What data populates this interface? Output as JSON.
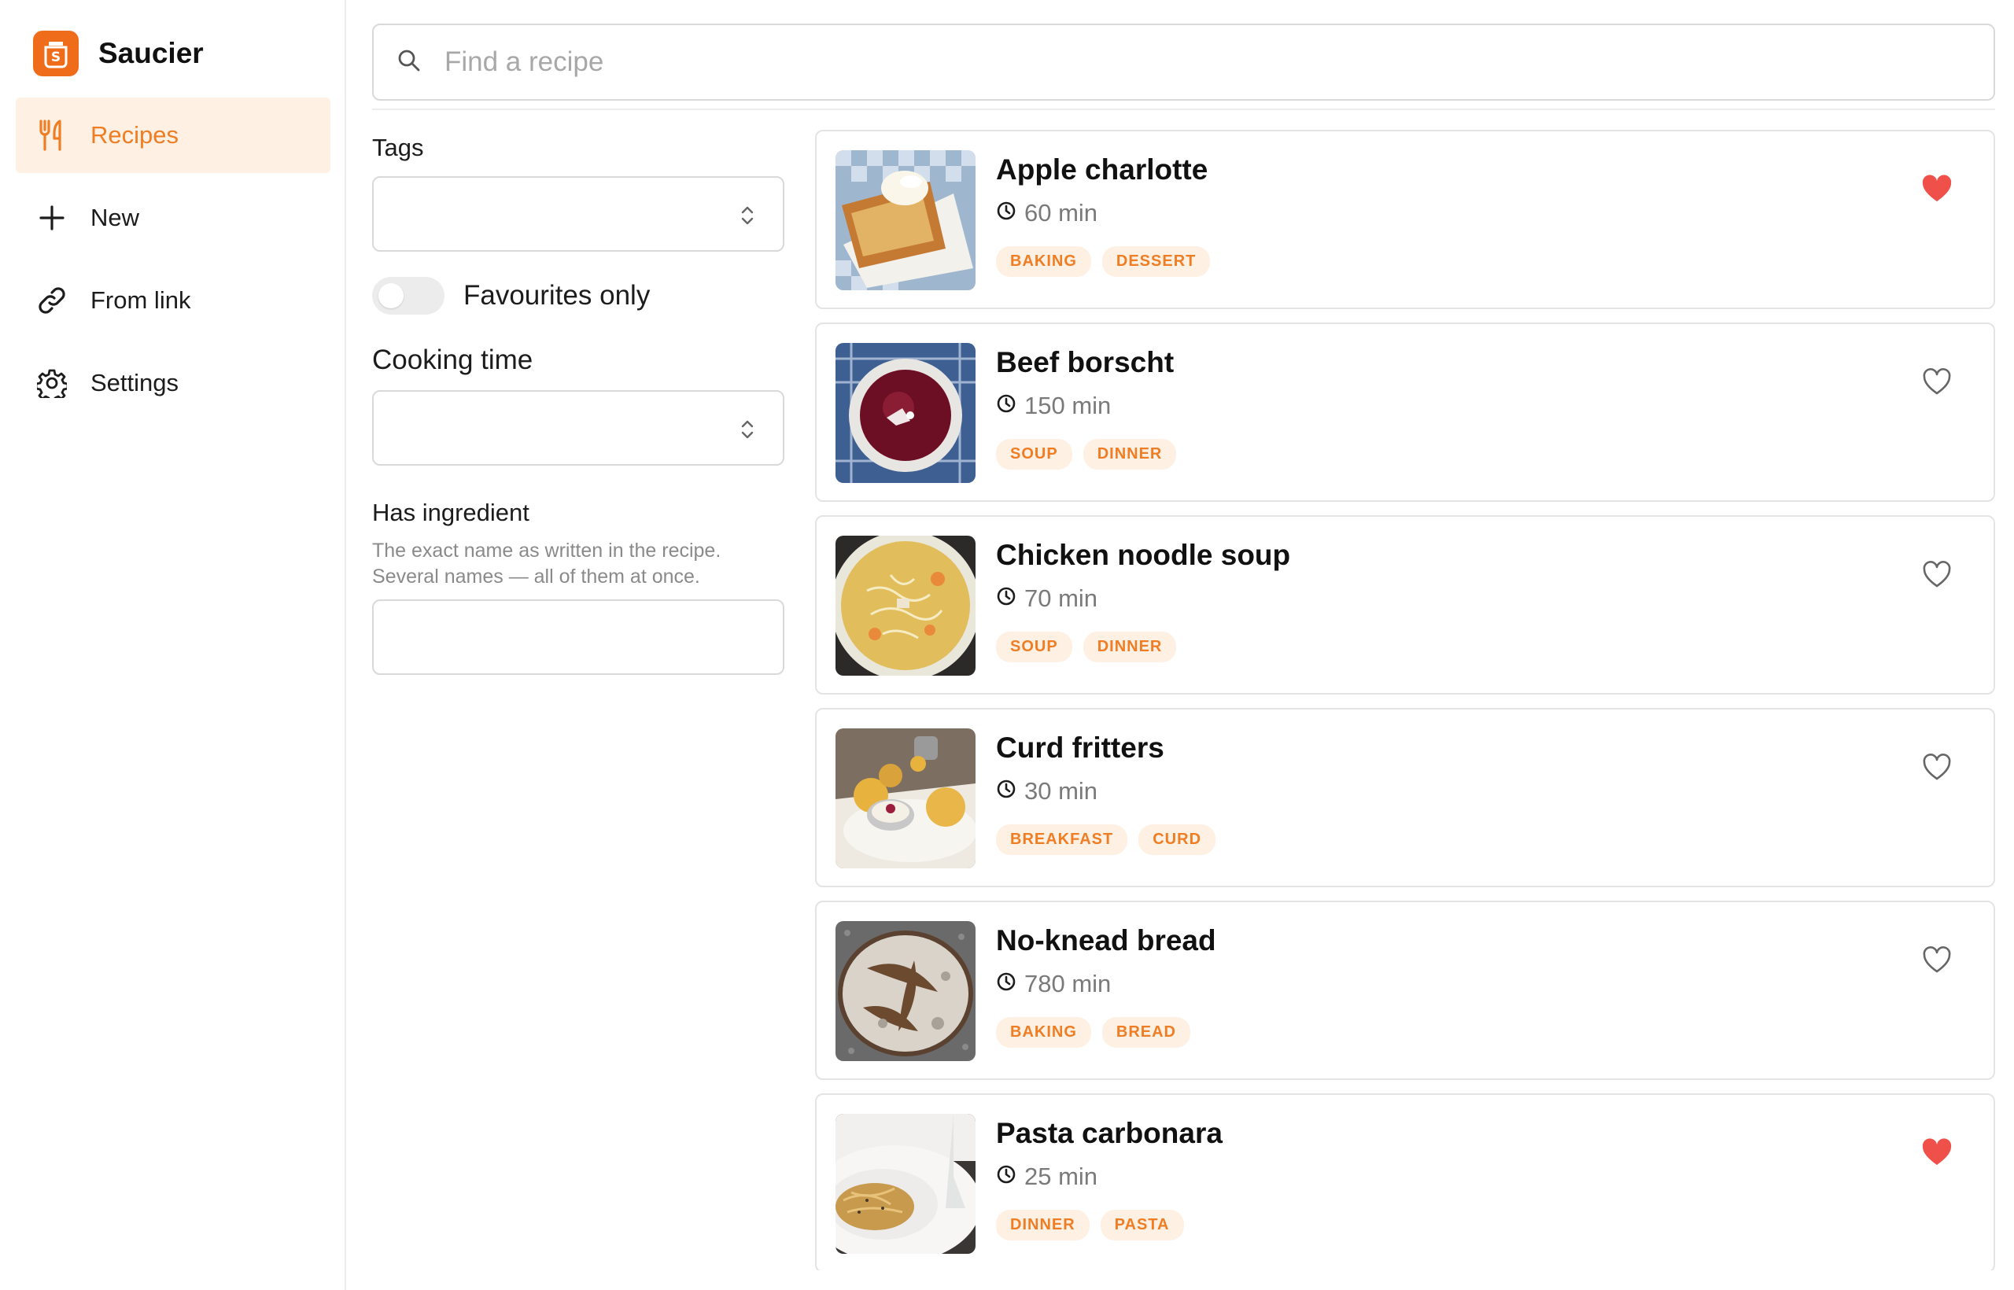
{
  "app": {
    "name": "Saucier"
  },
  "sidebar": {
    "items": [
      {
        "label": "Recipes",
        "icon": "fork-knife-icon",
        "active": true
      },
      {
        "label": "New",
        "icon": "plus-icon",
        "active": false
      },
      {
        "label": "From link",
        "icon": "link-icon",
        "active": false
      },
      {
        "label": "Settings",
        "icon": "gear-icon",
        "active": false
      }
    ]
  },
  "search": {
    "placeholder": "Find a recipe",
    "value": ""
  },
  "filters": {
    "tags_label": "Tags",
    "tags_value": "",
    "favourites_label": "Favourites only",
    "favourites_on": false,
    "cooking_time_label": "Cooking time",
    "cooking_time_value": "",
    "ingredient_label": "Has ingredient",
    "ingredient_desc_1": "The exact name as written in the recipe.",
    "ingredient_desc_2": "Several names — all of them at once.",
    "ingredient_value": ""
  },
  "recipes": [
    {
      "title": "Apple charlotte",
      "time": "60 min",
      "tags": [
        "BAKING",
        "DESSERT"
      ],
      "favourite": true
    },
    {
      "title": "Beef borscht",
      "time": "150 min",
      "tags": [
        "SOUP",
        "DINNER"
      ],
      "favourite": false
    },
    {
      "title": "Chicken noodle soup",
      "time": "70 min",
      "tags": [
        "SOUP",
        "DINNER"
      ],
      "favourite": false
    },
    {
      "title": "Curd fritters",
      "time": "30 min",
      "tags": [
        "BREAKFAST",
        "CURD"
      ],
      "favourite": false
    },
    {
      "title": "No-knead bread",
      "time": "780 min",
      "tags": [
        "BAKING",
        "BREAD"
      ],
      "favourite": false
    },
    {
      "title": "Pasta carbonara",
      "time": "25 min",
      "tags": [
        "DINNER",
        "PASTA"
      ],
      "favourite": true
    }
  ],
  "colors": {
    "accent": "#ef7d23",
    "accent_bg": "#fff0e4",
    "favourite": "#f0504a",
    "border": "#d9d9d9"
  }
}
